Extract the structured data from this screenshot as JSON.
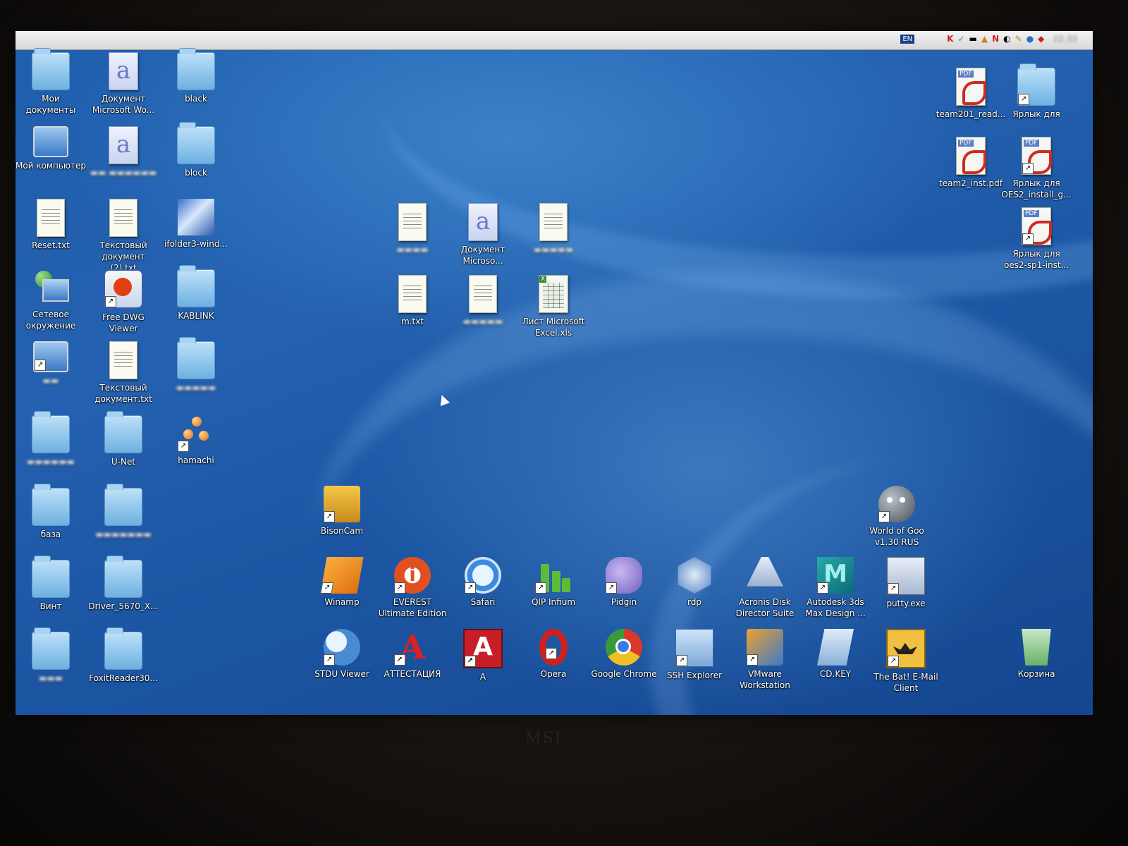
{
  "menubar": {
    "apple_glyph": "",
    "tray": {
      "lang": "EN",
      "icons": [
        "K",
        "N"
      ],
      "clock": "22:33"
    }
  },
  "desktop_left": [
    {
      "label": "Мои документы",
      "icon": "my-documents-icon"
    },
    {
      "label": "Документ Microsoft Wo...",
      "icon": "word-document-icon"
    },
    {
      "label": "black",
      "icon": "folder-icon"
    },
    {
      "label": "Мой компьютер",
      "icon": "my-computer-icon"
    },
    {
      "label": "block",
      "icon": "folder-icon"
    },
    {
      "label": "Reset.txt",
      "icon": "text-file-icon"
    },
    {
      "label": "Текстовый документ (2).txt",
      "icon": "text-file-icon"
    },
    {
      "label": "ifolder3-wind...",
      "icon": "ifolder-icon"
    },
    {
      "label": "Сетевое окружение",
      "icon": "network-icon"
    },
    {
      "label": "Free DWG Viewer",
      "icon": "dwg-viewer-icon"
    },
    {
      "label": "KABLINK",
      "icon": "folder-icon"
    },
    {
      "label": "Текстовый документ.txt",
      "icon": "text-file-icon"
    },
    {
      "label": "U-Net",
      "icon": "folder-icon"
    },
    {
      "label": "hamachi",
      "icon": "hamachi-icon"
    },
    {
      "label": "база",
      "icon": "folder-icon"
    },
    {
      "label": "Винт",
      "icon": "folder-icon"
    },
    {
      "label": "Driver_5670_X...",
      "icon": "folder-icon"
    },
    {
      "label": "FoxitReader30...",
      "icon": "folder-icon"
    }
  ],
  "desktop_center": [
    {
      "label": "Документ Microso...",
      "icon": "word-document-icon"
    },
    {
      "label": "m.txt",
      "icon": "text-file-icon"
    },
    {
      "label": "Лист Microsoft Excel.xls",
      "icon": "excel-file-icon"
    }
  ],
  "desktop_right": [
    {
      "label": "team201_read...",
      "icon": "pdf-icon"
    },
    {
      "label": "Ярлык для",
      "icon": "folder-shortcut-icon"
    },
    {
      "label": "team2_inst.pdf",
      "icon": "pdf-icon"
    },
    {
      "label": "Ярлык для OES2_install_g...",
      "icon": "pdf-shortcut-icon"
    },
    {
      "label": "Ярлык для oes2-sp1-inst...",
      "icon": "pdf-shortcut-icon"
    }
  ],
  "apps_row1": [
    {
      "label": "BisonCam",
      "icon": "bisoncam-icon"
    },
    {
      "label": "World of Goo v1.30 RUS",
      "icon": "world-of-goo-icon"
    }
  ],
  "apps_row2": [
    {
      "label": "Winamp",
      "icon": "winamp-icon"
    },
    {
      "label": "EVEREST Ultimate Edition",
      "icon": "everest-icon"
    },
    {
      "label": "Safari",
      "icon": "safari-icon"
    },
    {
      "label": "QIP Infium",
      "icon": "qip-icon"
    },
    {
      "label": "Pidgin",
      "icon": "pidgin-icon"
    },
    {
      "label": "rdp",
      "icon": "rdp-icon"
    },
    {
      "label": "Acronis Disk Director Suite",
      "icon": "acronis-icon"
    },
    {
      "label": "Autodesk 3ds Max Design ...",
      "icon": "autodesk-icon"
    },
    {
      "label": "putty.exe",
      "icon": "putty-icon"
    }
  ],
  "apps_row3": [
    {
      "label": "STDU Viewer",
      "icon": "stdu-viewer-icon"
    },
    {
      "label": "АТТЕСТАЦИЯ",
      "icon": "attestation-icon"
    },
    {
      "label": "A",
      "icon": "a-app-icon"
    },
    {
      "label": "Opera",
      "icon": "opera-icon"
    },
    {
      "label": "Google Chrome",
      "icon": "chrome-icon"
    },
    {
      "label": "SSH Explorer",
      "icon": "ssh-explorer-icon"
    },
    {
      "label": "VMware Workstation",
      "icon": "vmware-icon"
    },
    {
      "label": "CD.KEY",
      "icon": "cdkey-icon"
    },
    {
      "label": "The Bat! E-Mail Client",
      "icon": "the-bat-icon"
    },
    {
      "label": "Корзина",
      "icon": "recycle-bin-icon"
    }
  ],
  "bezel": {
    "brand": "MSI"
  }
}
